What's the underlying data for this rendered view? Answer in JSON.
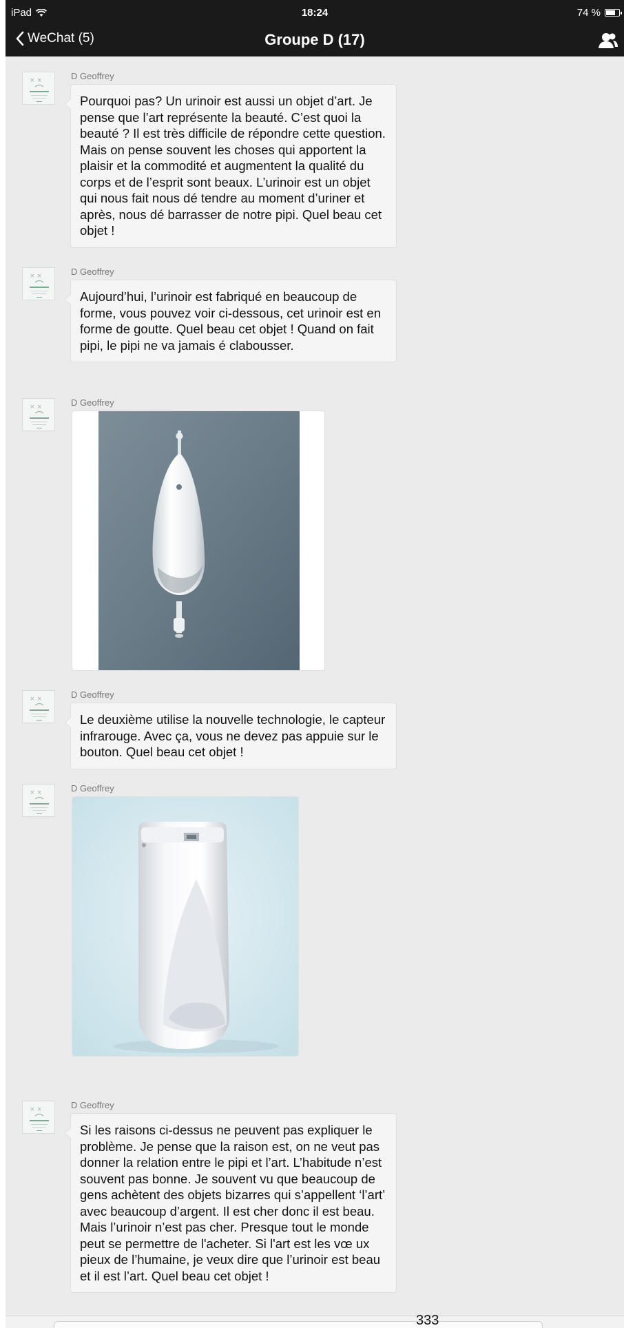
{
  "status_bar": {
    "device": "iPad",
    "time": "18:24",
    "battery": "74 %",
    "battery_level": 0.74
  },
  "nav": {
    "back_label": "WeChat (5)",
    "title": "Groupe D (17)"
  },
  "messages": [
    {
      "sender": "D Geoffrey",
      "type": "text",
      "text": "Pourquoi pas? Un urinoir est aussi un objet d’art. Je pense que l’art représente la beauté. C’est quoi la beauté ? Il est très difficile de répondre cette question. Mais on pense souvent les choses qui apportent la plaisir et la commodité et augmentent la qualité du corps et de l’esprit sont beaux. L’urinoir est un objet qui nous fait nous dé tendre au moment d’uriner et après, nous dé barrasser de notre pipi. Quel beau cet objet !"
    },
    {
      "sender": "D Geoffrey",
      "type": "text",
      "text": "Aujourd’hui, l’urinoir est fabriqué en beaucoup de forme, vous pouvez voir ci-dessous, cet urinoir est en forme de goutte. Quel beau cet objet ! Quand on fait pipi, le pipi ne va jamais é clabousser."
    },
    {
      "sender": "D Geoffrey",
      "type": "image",
      "image": "wall-mounted-urinal-photo"
    },
    {
      "sender": "D Geoffrey",
      "type": "text",
      "text": "Le deuxième utilise la nouvelle technologie, le capteur infrarouge. Avec ça, vous ne devez pas appuie sur le bouton. Quel beau cet objet !"
    },
    {
      "sender": "D Geoffrey",
      "type": "image",
      "image": "floor-standing-sensor-urinal-photo"
    },
    {
      "sender": "D Geoffrey",
      "type": "text",
      "text": "Si les raisons ci-dessus ne peuvent pas expliquer le problème. Je pense que la raison est, on ne veut pas donner la relation entre le pipi et l’art. L’habitude n’est souvent pas bonne. Je souvent vu que beaucoup de gens achètent des objets bizarres qui s’appellent ‘l’art’ avec beaucoup d’argent. Il est cher donc il est beau. Mais l’urinoir n’est pas cher. Presque tout le monde peut se permettre de l'acheter. Si l'art est les vœ ux pieux de l’humaine, je veux dire que l’urinoir est beau et il est l’art. Quel beau cet objet !"
    }
  ],
  "page_number": "333",
  "colors": {
    "nav_background": "#1a1a1a",
    "chat_background": "#ebebeb",
    "bubble_background": "#f5f5f5"
  }
}
